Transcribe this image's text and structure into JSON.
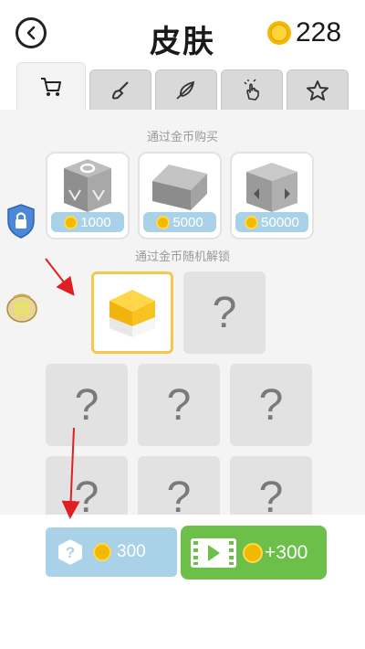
{
  "header": {
    "title": "皮肤",
    "coin_count": "228"
  },
  "tabs": [
    {
      "name": "shop",
      "icon": "cart-icon",
      "active": true
    },
    {
      "name": "paint",
      "icon": "brush-icon"
    },
    {
      "name": "feather",
      "icon": "feather-icon"
    },
    {
      "name": "tap",
      "icon": "tap-hand-icon"
    },
    {
      "name": "favorites",
      "icon": "star-icon"
    }
  ],
  "sections": {
    "buy_label": "通过金币购买",
    "random_label": "通过金币随机解锁"
  },
  "shop_items": [
    {
      "price": "1000",
      "skin": "gray-cube-with-ring"
    },
    {
      "price": "5000",
      "skin": "gray-house-block"
    },
    {
      "price": "50000",
      "skin": "gray-wedge-block"
    }
  ],
  "random_slots": [
    "",
    "?",
    "?",
    "?",
    "?",
    "?",
    "?",
    "?"
  ],
  "buttons": {
    "random_unlock_price": "300",
    "video_reward": "+300"
  },
  "colors": {
    "accent_blue": "#a9d1e8",
    "video_green": "#6cc04a",
    "selected_border": "#f2c94c",
    "coin": "#f2b900",
    "arrow_red": "#e02020"
  }
}
